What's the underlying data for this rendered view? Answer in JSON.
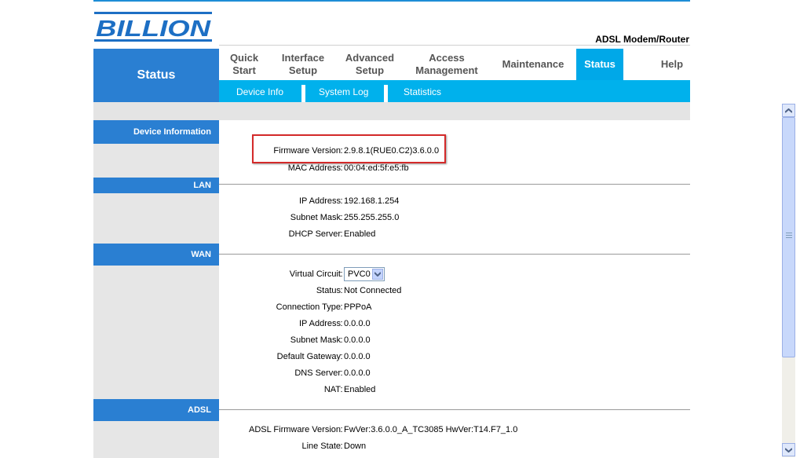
{
  "brand": {
    "logo_text": "BILLION",
    "product": "ADSL Modem/Router"
  },
  "section_title": "Status",
  "nav": [
    {
      "label1": "Quick",
      "label2": "Start"
    },
    {
      "label1": "Interface",
      "label2": "Setup"
    },
    {
      "label1": "Advanced",
      "label2": "Setup"
    },
    {
      "label1": "Access",
      "label2": "Management"
    },
    {
      "label1": "Maintenance",
      "label2": ""
    },
    {
      "label1": "Status",
      "label2": ""
    },
    {
      "label1": "Help",
      "label2": ""
    }
  ],
  "active_nav": "Status",
  "subnav": [
    "Device Info",
    "System Log",
    "Statistics"
  ],
  "sections": {
    "device": {
      "title": "Device Information",
      "rows": [
        {
          "label": "Firmware Version",
          "value": "2.9.8.1(RUE0.C2)3.6.0.0"
        },
        {
          "label": "MAC Address",
          "value": "00:04:ed:5f:e5:fb"
        }
      ]
    },
    "lan": {
      "title": "LAN",
      "rows": [
        {
          "label": "IP Address",
          "value": "192.168.1.254"
        },
        {
          "label": "Subnet Mask",
          "value": "255.255.255.0"
        },
        {
          "label": "DHCP Server",
          "value": "Enabled"
        }
      ]
    },
    "wan": {
      "title": "WAN",
      "virtual_circuit_label": "Virtual Circuit",
      "virtual_circuit_value": "PVC0",
      "rows": [
        {
          "label": "Status",
          "value": "Not Connected"
        },
        {
          "label": "Connection Type",
          "value": "PPPoA"
        },
        {
          "label": "IP Address",
          "value": "0.0.0.0"
        },
        {
          "label": "Subnet Mask",
          "value": "0.0.0.0"
        },
        {
          "label": "Default Gateway",
          "value": "0.0.0.0"
        },
        {
          "label": "DNS Server",
          "value": "0.0.0.0"
        },
        {
          "label": "NAT",
          "value": "Enabled"
        }
      ]
    },
    "adsl": {
      "title": "ADSL",
      "rows": [
        {
          "label": "ADSL Firmware Version",
          "value": "FwVer:3.6.0.0_A_TC3085 HwVer:T14.F7_1.0"
        },
        {
          "label": "Line State",
          "value": "Down"
        }
      ]
    }
  },
  "separator": ":",
  "colors": {
    "primary_blue": "#2a7fd2",
    "subnav_cyan": "#00b1ec",
    "highlight_red": "#d42a2a"
  }
}
